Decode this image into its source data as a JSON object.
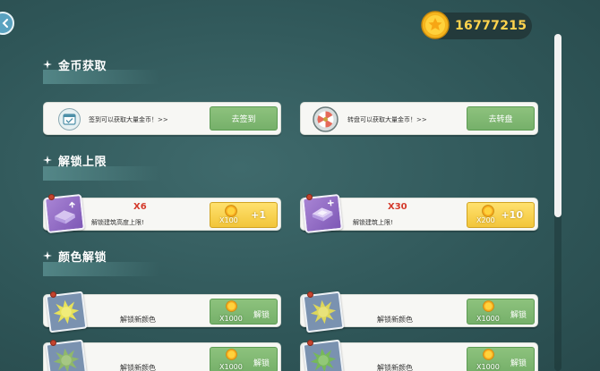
{
  "header": {
    "coins": "16777215"
  },
  "sections": {
    "coins": {
      "title": "金币获取"
    },
    "unlock": {
      "title": "解锁上限"
    },
    "colors": {
      "title": "颜色解锁"
    }
  },
  "coin_tasks": [
    {
      "text": "签到可以获取大量金币！>>",
      "button": "去签到",
      "icon": "calendar-icon"
    },
    {
      "text": "转盘可以获取大量金币！>>",
      "button": "去转盘",
      "icon": "spin-wheel-icon"
    }
  ],
  "unlock_items": [
    {
      "multiplier": "X6",
      "text": "解锁建筑高度上限!",
      "cost": "X100",
      "gain": "+1"
    },
    {
      "multiplier": "X30",
      "text": "解锁建筑上限!",
      "cost": "X200",
      "gain": "+10"
    }
  ],
  "color_items": [
    {
      "text": "解锁新颜色",
      "cost": "X1000",
      "button": "解锁",
      "splat": "#e8e25a"
    },
    {
      "text": "解锁新颜色",
      "cost": "X1000",
      "button": "解锁",
      "splat": "#ddd65a"
    },
    {
      "text": "解锁新颜色",
      "cost": "X1000",
      "button": "解锁",
      "splat": "#8fb86a"
    },
    {
      "text": "解锁新颜色",
      "cost": "X1000",
      "button": "解锁",
      "splat": "#76b85a"
    }
  ],
  "colors": {
    "background": "#2f5658",
    "coin_text": "#ffd34d",
    "green_button": "#76b06a",
    "yellow_button": "#f2c53a",
    "multiplier_red": "#d43a2b"
  }
}
